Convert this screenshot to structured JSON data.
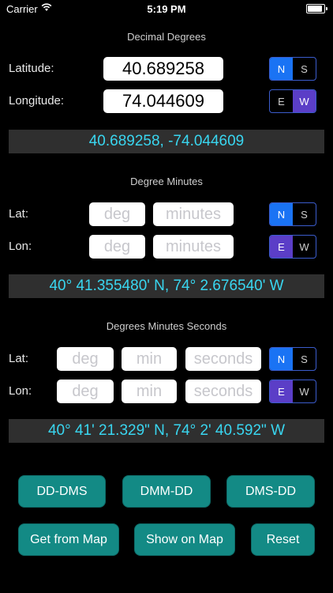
{
  "status_bar": {
    "carrier": "Carrier",
    "time": "5:19 PM"
  },
  "decimal": {
    "title": "Decimal Degrees",
    "lat_label": "Latitude:",
    "lat_value": "40.689258",
    "lat_ns": {
      "n": "N",
      "s": "S",
      "selected": "N"
    },
    "lon_label": "Longitude:",
    "lon_value": "74.044609",
    "lon_ew": {
      "e": "E",
      "w": "W",
      "selected": "W"
    },
    "result": "40.689258, -74.044609"
  },
  "dm": {
    "title": "Degree Minutes",
    "lat_label": "Lat:",
    "lon_label": "Lon:",
    "deg_placeholder": "deg",
    "min_placeholder": "minutes",
    "lat_ns": {
      "n": "N",
      "s": "S",
      "selected": "N"
    },
    "lon_ew": {
      "e": "E",
      "w": "W",
      "selected": "E"
    },
    "result": "40° 41.355480' N, 74° 2.676540' W"
  },
  "dms": {
    "title": "Degrees Minutes Seconds",
    "lat_label": "Lat:",
    "lon_label": "Lon:",
    "deg_placeholder": "deg",
    "min_placeholder": "min",
    "sec_placeholder": "seconds",
    "lat_ns": {
      "n": "N",
      "s": "S",
      "selected": "N"
    },
    "lon_ew": {
      "e": "E",
      "w": "W",
      "selected": "E"
    },
    "result": "40° 41' 21.329\"  N, 74° 2' 40.592\" W"
  },
  "buttons": {
    "dd_dms": "DD-DMS",
    "dmm_dd": "DMM-DD",
    "dms_dd": "DMS-DD",
    "get_from_map": "Get from Map",
    "show_on_map": "Show on Map",
    "reset": "Reset"
  },
  "colors": {
    "accent_blue": "#1a73f4",
    "accent_purple": "#5b3ec7",
    "result_text": "#39d6f0",
    "button_bg": "#138a85"
  }
}
